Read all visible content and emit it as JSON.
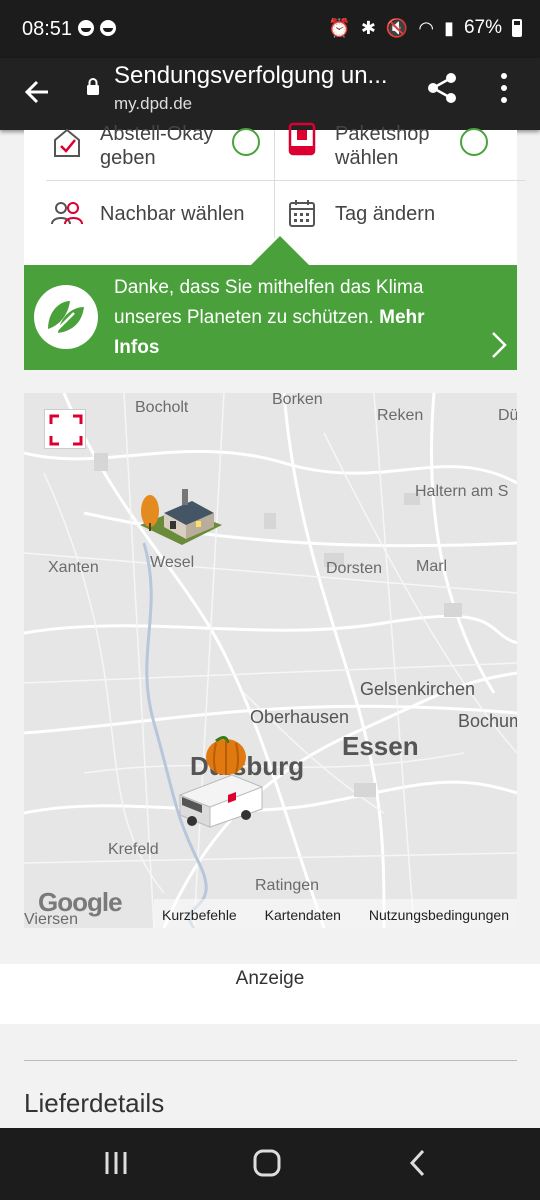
{
  "status_bar": {
    "time": "08:51",
    "battery": "67%"
  },
  "app_bar": {
    "title": "Sendungsverfolgung un...",
    "url": "my.dpd.de"
  },
  "options": {
    "item1": "Abstell-Okay geben",
    "item2": "Paketshop wählen",
    "item3": "Nachbar wählen",
    "item4": "Tag ändern"
  },
  "banner": {
    "text": "Danke, dass Sie mithelfen das Klima unseres Planeten zu schützen.",
    "link": "Mehr Infos"
  },
  "map": {
    "cities": {
      "bocholt": "Bocholt",
      "borken": "Borken",
      "reken": "Reken",
      "du": "Dü",
      "haltern": "Haltern am S",
      "xanten": "Xanten",
      "wesel": "Wesel",
      "dorsten": "Dorsten",
      "marl": "Marl",
      "gelsenkirchen": "Gelsenkirchen",
      "oberhausen": "Oberhausen",
      "bochum": "Bochum",
      "essen": "Essen",
      "duisburg": "Duisburg",
      "krefeld": "Krefeld",
      "ratingen": "Ratingen",
      "viersen": "Viersen"
    },
    "google": "Google",
    "footer": {
      "shortcuts": "Kurzbefehle",
      "map_data": "Kartendaten",
      "terms": "Nutzungsbedingungen"
    }
  },
  "ad_label": "Anzeige",
  "section_title": "Lieferdetails",
  "colors": {
    "brand_green": "#4aa13b",
    "dpd_red": "#dc0032",
    "dark_bar": "#222222"
  }
}
